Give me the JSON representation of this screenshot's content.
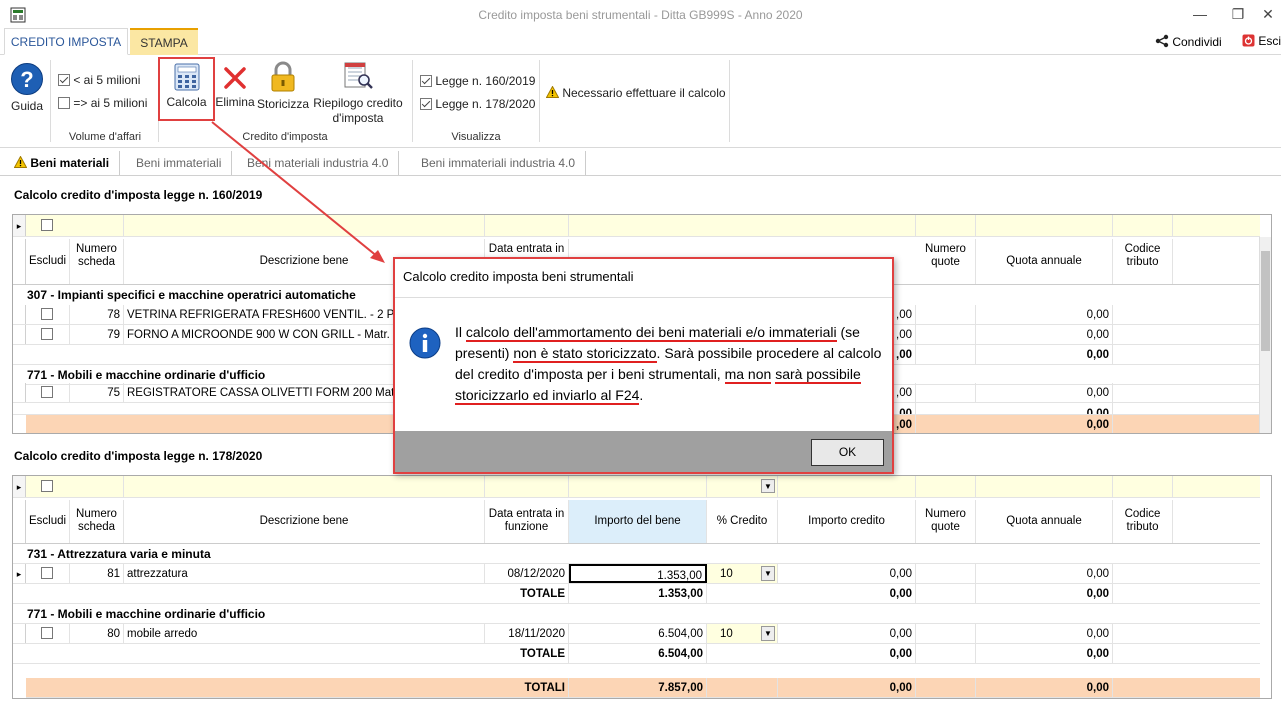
{
  "window": {
    "title": "Credito imposta beni strumentali  -  Ditta GB999S - Anno 2020",
    "minimize": "—",
    "restore": "❐",
    "close": "✕"
  },
  "ribbon_tabs": [
    "CREDITO IMPOSTA",
    "STAMPA"
  ],
  "top_right": {
    "condividi": "Condividi",
    "esci": "Esci"
  },
  "ribbon": {
    "guida": "Guida",
    "volume": {
      "opt1": "< ai 5 milioni",
      "opt2": "=> ai 5 milioni",
      "group": "Volume d'affari"
    },
    "credito": {
      "calcola": "Calcola",
      "elimina": "Elimina",
      "storicizza": "Storicizza",
      "riepilogo1": "Riepilogo credito",
      "riepilogo2": "d'imposta",
      "group": "Credito d'imposta"
    },
    "visualizza": {
      "legge1": "Legge n. 160/2019",
      "legge2": "Legge n. 178/2020",
      "group": "Visualizza"
    },
    "warning": "Necessario effettuare il calcolo"
  },
  "section_tabs": [
    "Beni materiali",
    "Beni immateriali",
    "Beni materiali industria 4.0",
    "Beni immateriali industria 4.0"
  ],
  "grid1": {
    "title": "Calcolo credito d'imposta legge n. 160/2019",
    "headers": {
      "escludi": "Escludi",
      "numero1": "Numero",
      "numero2": "scheda",
      "descrizione": "Descrizione bene",
      "data": "Data entrata in",
      "numquote1": "Numero",
      "numquote2": "quote",
      "quota": "Quota annuale",
      "codice1": "Codice",
      "codice2": "tributo"
    },
    "group1": "307 - Impianti specifici e macchine operatrici automatiche",
    "row1": {
      "num": "78",
      "desc": "VETRINA REFRIGERATA FRESH600 VENTIL. - 2 PORT",
      "imp": ",00",
      "quota": "0,00"
    },
    "row2": {
      "num": "79",
      "desc": "FORNO A MICROONDE 900 W CON GRILL - Matr.",
      "imp": ",00",
      "quota": "0,00"
    },
    "tot1": {
      "imp": ",00",
      "quota": "0,00"
    },
    "group2": "771 - Mobili e macchine ordinarie d'ufficio",
    "row3": {
      "num": "75",
      "desc": "REGISTRATORE CASSA OLIVETTI FORM 200 Matr. 80",
      "imp": ",00",
      "quota": "0,00"
    },
    "tot2": {
      "imp": ",00",
      "quota": "0,00"
    },
    "grand": {
      "imp": ",00",
      "quota": "0,00"
    }
  },
  "grid2": {
    "title": "Calcolo credito d'imposta legge n. 178/2020",
    "headers": {
      "escludi": "Escludi",
      "numero1": "Numero",
      "numero2": "scheda",
      "descrizione": "Descrizione bene",
      "data1": "Data entrata in",
      "data2": "funzione",
      "importo": "Importo del bene",
      "perc": "% Credito",
      "credito": "Importo credito",
      "numquote1": "Numero",
      "numquote2": "quote",
      "quota": "Quota annuale",
      "codice1": "Codice",
      "codice2": "tributo"
    },
    "group1": "731 - Attrezzatura varia e minuta",
    "row1": {
      "num": "81",
      "desc": "attrezzatura",
      "data": "08/12/2020",
      "importo": "1.353,00",
      "perc": "10",
      "credito": "0,00",
      "quota": "0,00"
    },
    "tot1": {
      "label": "TOTALE",
      "importo": "1.353,00",
      "credito": "0,00",
      "quota": "0,00"
    },
    "group2": "771 - Mobili e macchine ordinarie d'ufficio",
    "row2": {
      "num": "80",
      "desc": "mobile arredo",
      "data": "18/11/2020",
      "importo": "6.504,00",
      "perc": "10",
      "credito": "0,00",
      "quota": "0,00"
    },
    "tot2": {
      "label": "TOTALE",
      "importo": "6.504,00",
      "credito": "0,00",
      "quota": "0,00"
    },
    "grand": {
      "label": "TOTALI",
      "importo": "7.857,00",
      "credito": "0,00",
      "quota": "0,00"
    }
  },
  "dialog": {
    "title": "Calcolo credito imposta beni strumentali",
    "msg_a": "Il ",
    "msg_b": "calcolo dell'ammortamento dei beni materiali e/o immateriali",
    "msg_c": " (se presenti) ",
    "msg_d": "non è stato storicizzato",
    "msg_e": ". Sarà possibile procedere al calcolo del credito d'imposta per i beni strumentali, ",
    "msg_f": "ma non",
    "msg_g": " ",
    "msg_h": "sarà possibile storicizzarlo ed inviarlo al F24",
    "msg_i": ".",
    "ok": "OK"
  }
}
